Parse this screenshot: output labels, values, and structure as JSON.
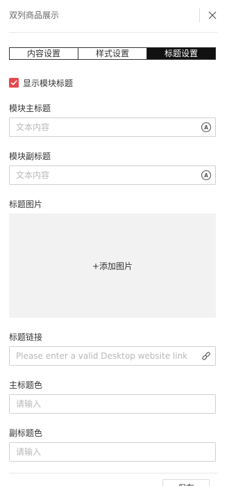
{
  "header": {
    "title": "双列商品展示"
  },
  "tabs": [
    {
      "label": "内容设置",
      "active": false
    },
    {
      "label": "样式设置",
      "active": false
    },
    {
      "label": "标题设置",
      "active": true
    }
  ],
  "show_title": {
    "label": "显示模块标题",
    "checked": true
  },
  "main_title": {
    "label": "模块主标题",
    "placeholder": "文本内容",
    "value": ""
  },
  "sub_title": {
    "label": "模块副标题",
    "placeholder": "文本内容",
    "value": ""
  },
  "title_image": {
    "label": "标题图片",
    "add_label": "+添加图片"
  },
  "title_link": {
    "label": "标题链接",
    "placeholder": "Please enter a valid Desktop website link",
    "value": ""
  },
  "main_title_color": {
    "label": "主标题色",
    "placeholder": "请输入",
    "value": ""
  },
  "sub_title_color": {
    "label": "副标题色",
    "placeholder": "请输入",
    "value": ""
  },
  "footer": {
    "save_label": "保存"
  },
  "colors": {
    "checkbox": "#e5484d",
    "active_tab_bg": "#111111",
    "image_box_bg": "#f2f2f2"
  }
}
